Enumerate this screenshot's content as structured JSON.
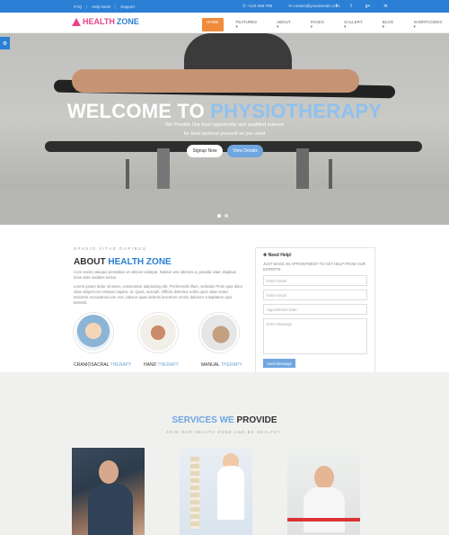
{
  "topbar": {
    "links": [
      "FAQ",
      "Help Desk",
      "Support"
    ],
    "phone": "+123-456-789",
    "email": "contact@yourdomain.com",
    "social_icons": [
      "facebook-icon",
      "twitter-icon",
      "google-plus-icon",
      "linkedin-icon"
    ],
    "social_glyphs": [
      "f",
      "t",
      "g+",
      "in"
    ]
  },
  "logo": {
    "word1": "HEALTH",
    "word2": "ZONE"
  },
  "menu": [
    "HOME",
    "FEATURES",
    "ABOUT",
    "PAGES",
    "GALLERY",
    "BLOG",
    "SHORTCODES"
  ],
  "hero": {
    "title_main": "WELCOME TO ",
    "title_highlight": "PHYSIOTHERAPY",
    "line1": "We Provide Our best opportunity and qualified trainers",
    "line2": "for best workout yourself as you want",
    "btn_signup": "Signup Now",
    "btn_details": "View Details"
  },
  "about": {
    "kicker": "SPASIO VITAE DAPIBUS",
    "title_main": "ABOUT ",
    "title_highlight": "HEALTH ZONE",
    "para1": "Cum sociis natoque penatibus et ultrices volutpat. Nullam wisi ultricies a, gravida vitae, dapibus risus ante sodales lectus.",
    "para2": "Lorem ipsum dolor sit amet, consectetur adipisicing elit. Perferendis illum, veritatis! Proin quis dolor vitae aliquet nec tempus sapien, id. Quos, suscipit. Officiis delectus nobis quos vitae sedur. Dolorem accusamus iure eos, ratione quae deleniti inventore omnis dolorum voluptatem quis. Deleniti.",
    "therapies": [
      {
        "name": "CRANIOSACRAL ",
        "hl": "THERAPY"
      },
      {
        "name": "HAND ",
        "hl": "THERAPY"
      },
      {
        "name": "MANUAL ",
        "hl": "THERAPY"
      }
    ]
  },
  "form": {
    "title": "Need Help!",
    "desc": "JUST MAKE AN APPOINTMENT TO GET HELP FROM OUR EXPERTS.",
    "name_placeholder": "Enter Name",
    "email_placeholder": "Enter Email",
    "date_placeholder": "Appointment Date",
    "message_placeholder": "Enter Message",
    "send_label": "Send Message"
  },
  "services": {
    "title_highlight": "SERVICES WE",
    "title_main": " PROVIDE",
    "subtitle": "JOIN OUR HEALTH ZONE AND BE HEALTHY."
  }
}
